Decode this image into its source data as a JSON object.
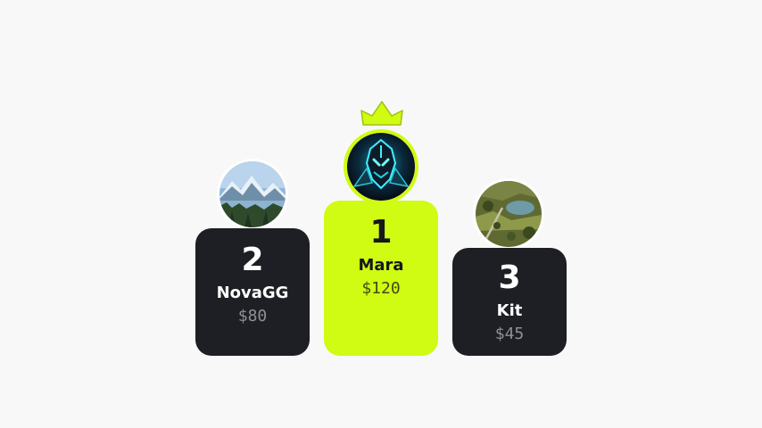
{
  "podium": {
    "second": {
      "rank": "2",
      "name": "NovaGG",
      "amount": "$80",
      "avatar_icon": "mountain-lake-avatar"
    },
    "first": {
      "rank": "1",
      "name": "Mara",
      "amount": "$120",
      "avatar_icon": "armored-knight-avatar"
    },
    "third": {
      "rank": "3",
      "name": "Kit",
      "amount": "$45",
      "avatar_icon": "countryside-aerial-avatar"
    }
  },
  "colors": {
    "accent": "#d0fb12",
    "dark_card": "#1d1f24",
    "background": "#f8f8f8"
  },
  "icons": {
    "winner_crown": "crown-icon"
  }
}
